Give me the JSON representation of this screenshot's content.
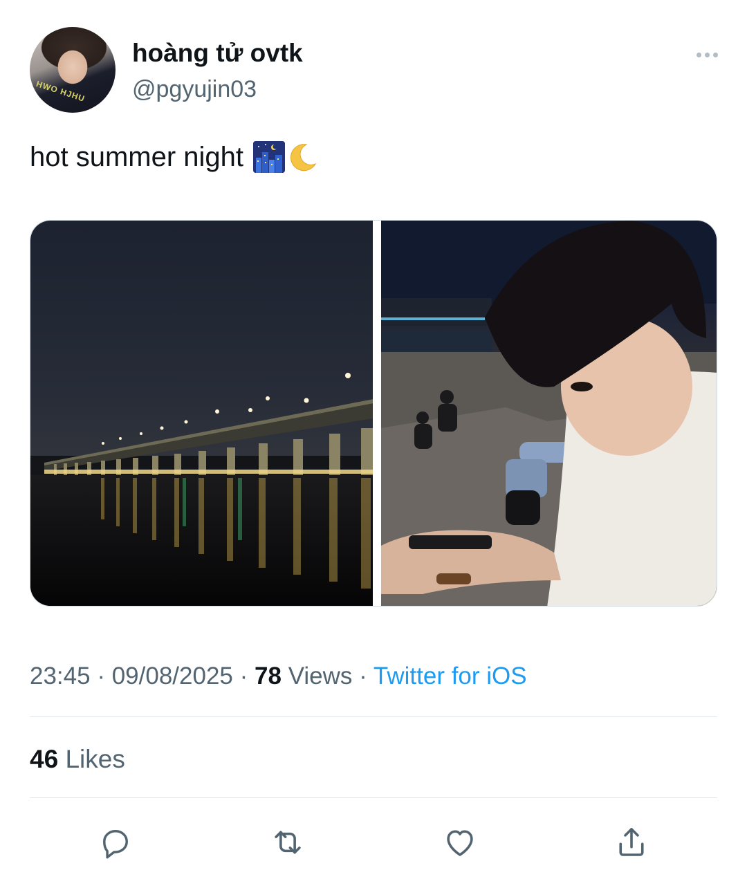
{
  "tweet": {
    "author": {
      "display_name": "hoàng tử ovtk",
      "handle": "@pgyujin03"
    },
    "text": "hot summer night",
    "emojis": [
      "night-city-emoji",
      "crescent-moon-emoji"
    ],
    "media": [
      {
        "icon": "photo-bridge-night"
      },
      {
        "icon": "photo-person-riverside"
      }
    ],
    "meta": {
      "time": "23:45",
      "sep1": "·",
      "date": "09/08/2025",
      "sep2": "·",
      "views_count": "78",
      "views_label": "Views",
      "sep3": "·",
      "source": "Twitter for iOS"
    },
    "likes": {
      "count": "46",
      "label": "Likes"
    }
  },
  "colors": {
    "text_primary": "#0f1419",
    "text_secondary": "#536471",
    "link": "#1d9bf0",
    "divider": "#dfe5e9",
    "icon": "#536471"
  },
  "actions": [
    {
      "icon": "reply-icon"
    },
    {
      "icon": "retweet-icon"
    },
    {
      "icon": "like-icon"
    },
    {
      "icon": "share-icon"
    }
  ]
}
